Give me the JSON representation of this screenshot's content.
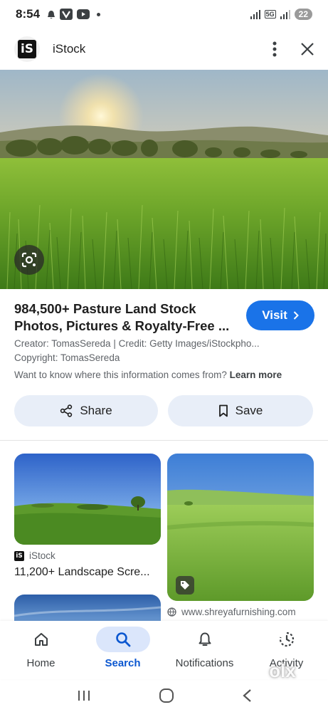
{
  "status_bar": {
    "time": "8:54",
    "network": "5G",
    "battery": "22"
  },
  "header": {
    "site_logo_text": "iS",
    "site_name": "iStock"
  },
  "result": {
    "title": "984,500+ Pasture Land Stock Photos, Pictures & Royalty-Free ...",
    "visit_label": "Visit",
    "creator_line": "Creator: TomasSereda | Credit: Getty Images/iStockpho...",
    "copyright_line": "Copyright: TomasSereda",
    "info_question": "Want to know where this information comes from?",
    "learn_more": "Learn more",
    "share_label": "Share",
    "save_label": "Save"
  },
  "related": [
    {
      "source": "iStock",
      "title": "11,200+ Landscape Scre..."
    },
    {
      "source": "www.shreyafurnishing.com"
    }
  ],
  "bottom_nav": [
    {
      "label": "Home",
      "icon": "home-icon"
    },
    {
      "label": "Search",
      "icon": "search-icon",
      "active": true
    },
    {
      "label": "Notifications",
      "icon": "bell-icon"
    },
    {
      "label": "Activity",
      "icon": "activity-icon"
    }
  ],
  "watermark": "olx",
  "colors": {
    "accent": "#1a73e8",
    "active_nav": "#0b57d0",
    "chip_bg": "#e8eef8"
  }
}
